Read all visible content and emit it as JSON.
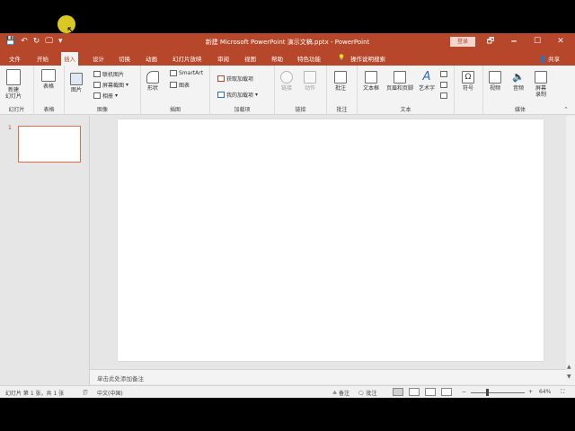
{
  "window": {
    "title": "新建 Microsoft PowerPoint 演示文稿.pptx - PowerPoint",
    "sign_in": "登录",
    "minimize_glyph": "🗕",
    "restore_glyph": "🗗",
    "maximize_glyph": "☐",
    "close_glyph": "✕"
  },
  "qat": {
    "save": "💾",
    "undo": "↶",
    "redo": "↻",
    "present": "🖵",
    "more": "▾"
  },
  "tabs": [
    "文件",
    "开始",
    "插入",
    "设计",
    "切换",
    "动画",
    "幻灯片放映",
    "审阅",
    "视图",
    "帮助",
    "特色功能"
  ],
  "tell_me": "操作说明搜索",
  "share": "共享",
  "ribbon": {
    "slides": {
      "label": "幻灯片",
      "new_slide": "新建\n幻灯片"
    },
    "tables": {
      "label": "表格",
      "table": "表格"
    },
    "images": {
      "label": "图像",
      "pictures": "图片",
      "online_pictures": "联机图片",
      "screenshot": "屏幕截图",
      "album": "相册"
    },
    "illustrations": {
      "label": "插图",
      "shapes": "形状",
      "smartart": "SmartArt",
      "chart": "图表"
    },
    "addins": {
      "label": "加载项",
      "get_addins": "获取加载项",
      "my_addins": "我的加载项"
    },
    "links": {
      "label": "链接",
      "link": "链接",
      "action": "动作"
    },
    "comments": {
      "label": "批注",
      "comment": "批注"
    },
    "text": {
      "label": "文本",
      "textbox": "文本框",
      "header_footer": "页眉和页脚",
      "wordart": "艺术字"
    },
    "symbols": {
      "label": "",
      "symbol": "符号"
    },
    "media": {
      "label": "媒体",
      "video": "视频",
      "audio": "音频",
      "screen_recording": "屏幕\n录制"
    }
  },
  "thumbnails": {
    "slide_number": "1"
  },
  "notes": {
    "placeholder": "单击此处添加备注"
  },
  "status": {
    "slide_info": "幻灯片 第 1 张，共 1 张",
    "language": "中文(中国)",
    "notes": "备注",
    "comments": "批注",
    "zoom": "64%",
    "zoom_percent": 64
  },
  "colors": {
    "accent": "#b7472a",
    "thumb_border": "#e26b4a"
  }
}
